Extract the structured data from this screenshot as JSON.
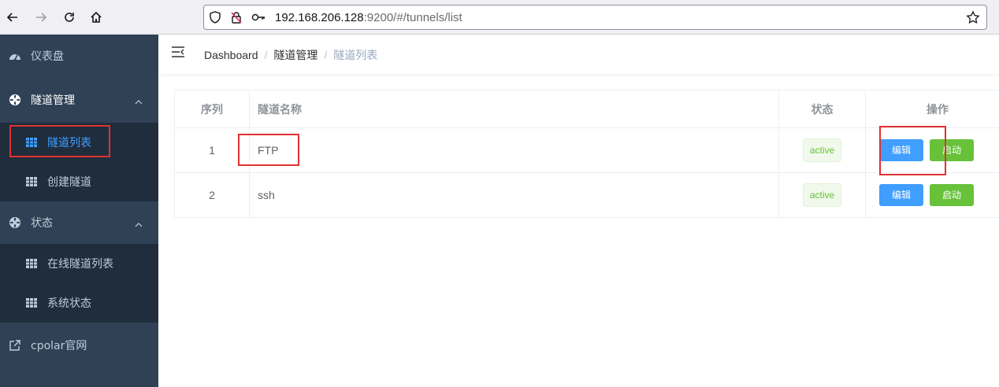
{
  "browser": {
    "url_host": "192.168.206.128",
    "url_path": ":9200/#/tunnels/list"
  },
  "sidebar": {
    "items": [
      {
        "label": "仪表盘",
        "icon": "dashboard-icon"
      },
      {
        "label": "隧道管理",
        "icon": "tunnel-manage-icon"
      },
      {
        "label": "隧道列表",
        "icon": "table-icon"
      },
      {
        "label": "创建隧道",
        "icon": "table-icon"
      },
      {
        "label": "状态",
        "icon": "status-icon"
      },
      {
        "label": "在线隧道列表",
        "icon": "table-icon"
      },
      {
        "label": "系统状态",
        "icon": "table-icon"
      },
      {
        "label": "cpolar官网",
        "icon": "external-link-icon"
      }
    ]
  },
  "breadcrumb": [
    "Dashboard",
    "隧道管理",
    "隧道列表"
  ],
  "table": {
    "headers": [
      "序列",
      "隧道名称",
      "状态",
      "操作"
    ],
    "rows": [
      {
        "index": "1",
        "name": "FTP",
        "status": "active",
        "edit": "编辑",
        "start": "启动"
      },
      {
        "index": "2",
        "name": "ssh",
        "status": "active",
        "edit": "编辑",
        "start": "启动"
      }
    ]
  },
  "colors": {
    "sidebar_bg": "#304156",
    "submenu_bg": "#1f2d3d",
    "active": "#409eff",
    "success": "#67c23a",
    "annotation": "#e03131"
  }
}
